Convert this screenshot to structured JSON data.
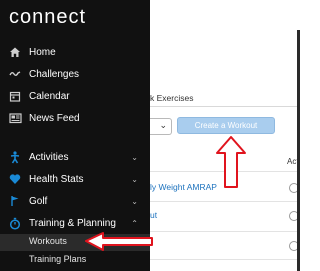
{
  "app": {
    "logo_text": "connect"
  },
  "sidebar": {
    "items": [
      {
        "label": "Home",
        "icon": "home-icon"
      },
      {
        "label": "Challenges",
        "icon": "wave-icon"
      },
      {
        "label": "Calendar",
        "icon": "calendar-icon"
      },
      {
        "label": "News Feed",
        "icon": "newsfeed-icon"
      },
      {
        "label": "Activities",
        "icon": "running-person-icon",
        "expandable": true
      },
      {
        "label": "Health Stats",
        "icon": "heart-icon",
        "expandable": true
      },
      {
        "label": "Golf",
        "icon": "golf-flag-icon",
        "expandable": true
      },
      {
        "label": "Training & Planning",
        "icon": "stopwatch-icon",
        "expandable": true,
        "expanded": true
      }
    ],
    "sub_items": [
      {
        "label": "Workouts",
        "selected": true
      },
      {
        "label": "Training Plans",
        "selected": false
      }
    ]
  },
  "main": {
    "tab_partial": "k Exercises",
    "create_button_label": "Create a Workout",
    "column_header_partial": "Act",
    "rows": [
      {
        "title_partial": "ly Weight AMRAP"
      },
      {
        "title_partial": "ut"
      },
      {
        "title_partial": ""
      }
    ]
  },
  "colors": {
    "sidebar_bg": "#111111",
    "accent_blue": "#1a8ad6",
    "link_blue": "#1e73be",
    "button_bg": "#a9cdee",
    "annotation_red": "#e0141e"
  }
}
